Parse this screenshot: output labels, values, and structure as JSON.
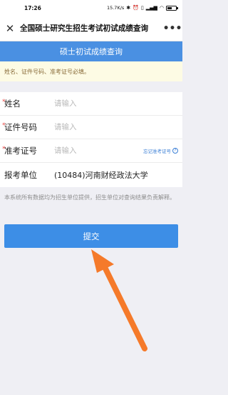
{
  "status_bar": {
    "time": "17:26",
    "speed": "15.7K/s",
    "battery": "60"
  },
  "title_bar": {
    "title": "全国硕士研究生招生考试初试成绩查询",
    "close_icon": "close-icon",
    "more_icon": "more-dots-icon"
  },
  "header": {
    "title": "硕士初试成绩查询"
  },
  "notice": {
    "text": "姓名、证件号码、准考证号必填。"
  },
  "form": {
    "name": {
      "label": "姓名",
      "placeholder": "请输入"
    },
    "id_number": {
      "label": "证件号码",
      "placeholder": "请输入"
    },
    "exam_number": {
      "label": "准考证号",
      "placeholder": "请输入",
      "forgot_label": "忘记准考证号"
    },
    "unit": {
      "label": "报考单位",
      "value": "(10484)河南财经政法大学"
    }
  },
  "disclaimer": "本系统所有数据均为招生单位提供，招生单位对查询结果负责解释。",
  "submit_label": "提交",
  "colors": {
    "accent": "#4a90e2",
    "button": "#3d8ee6",
    "arrow": "#f57a2a",
    "required": "#e64340"
  }
}
